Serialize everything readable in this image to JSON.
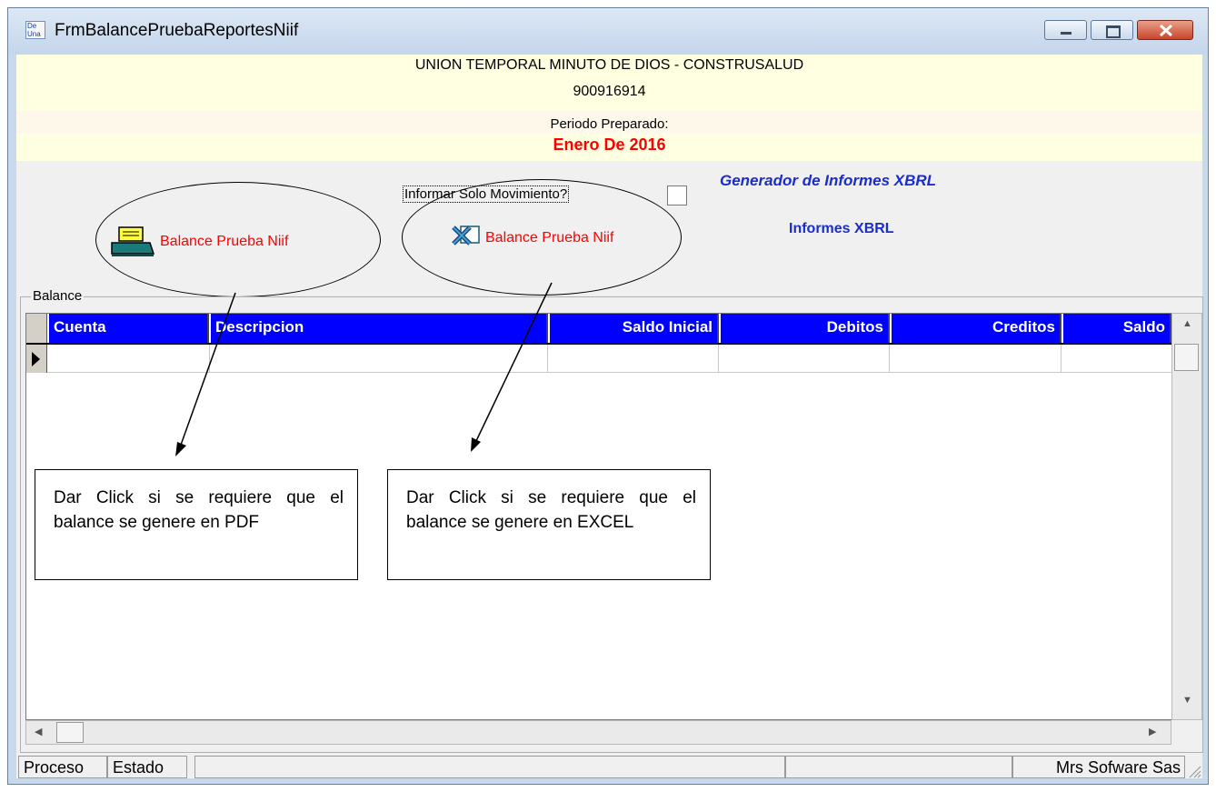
{
  "window": {
    "title": "FrmBalancePruebaReportesNiif",
    "icon_text": "De Una"
  },
  "header": {
    "company": "UNION TEMPORAL MINUTO DE DIOS - CONSTRUSALUD",
    "nit": "900916914",
    "periodo_label": "Periodo Preparado:",
    "periodo_value": "Enero De 2016"
  },
  "options": {
    "checkbox_label": "Informar Solo Movimiento?",
    "checkbox_checked": false,
    "pdf_button_label": "Balance Prueba Niif",
    "excel_button_label": "Balance Prueba Niif",
    "xbrl_title": "Generador de Informes XBRL",
    "xbrl_link": "Informes XBRL"
  },
  "balance": {
    "group_label": "Balance",
    "columns": [
      "Cuenta",
      "Descripcion",
      "Saldo Inicial",
      "Debitos",
      "Creditos",
      "Saldo"
    ],
    "rows": [
      [
        "",
        "",
        "",
        "",
        "",
        ""
      ]
    ]
  },
  "statusbar": {
    "proceso": "Proceso",
    "estado": "Estado",
    "message": "",
    "empty": "",
    "company": "Mrs Sofware Sas"
  },
  "annotations": {
    "pdf": "Dar Click si se requiere que el balance se genere en PDF",
    "excel": "Dar Click si se requiere que el balance se genere en EXCEL"
  },
  "colors": {
    "header_bg": "#ffffe1",
    "grid_header": "#0000ff",
    "accent_red": "#ff0000",
    "xbrl_blue": "#1a2ccc"
  }
}
